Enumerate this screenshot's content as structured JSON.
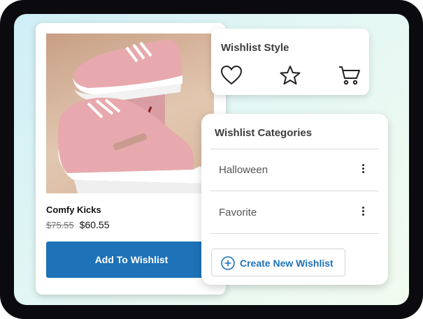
{
  "product": {
    "name": "Comfy Kicks",
    "old_price": "$75.55",
    "price": "$60.55",
    "add_button_label": "Add To Wishlist",
    "image_subject": "pink-and-white-platform-sneakers"
  },
  "wishlist_style": {
    "title": "Wishlist Style",
    "icons": [
      "heart-icon",
      "star-icon",
      "cart-icon"
    ]
  },
  "wishlist_categories": {
    "title": "Wishlist Categories",
    "items": [
      {
        "label": "Halloween",
        "menu_icon": "kebab-menu-icon"
      },
      {
        "label": "Favorite",
        "menu_icon": "kebab-menu-icon"
      }
    ],
    "create_button_label": "Create New Wishlist",
    "create_icon": "plus-circle-icon"
  },
  "colors": {
    "accent": "#1d72b8",
    "device_frame": "#0b0b0f",
    "card_bg": "#ffffff"
  }
}
